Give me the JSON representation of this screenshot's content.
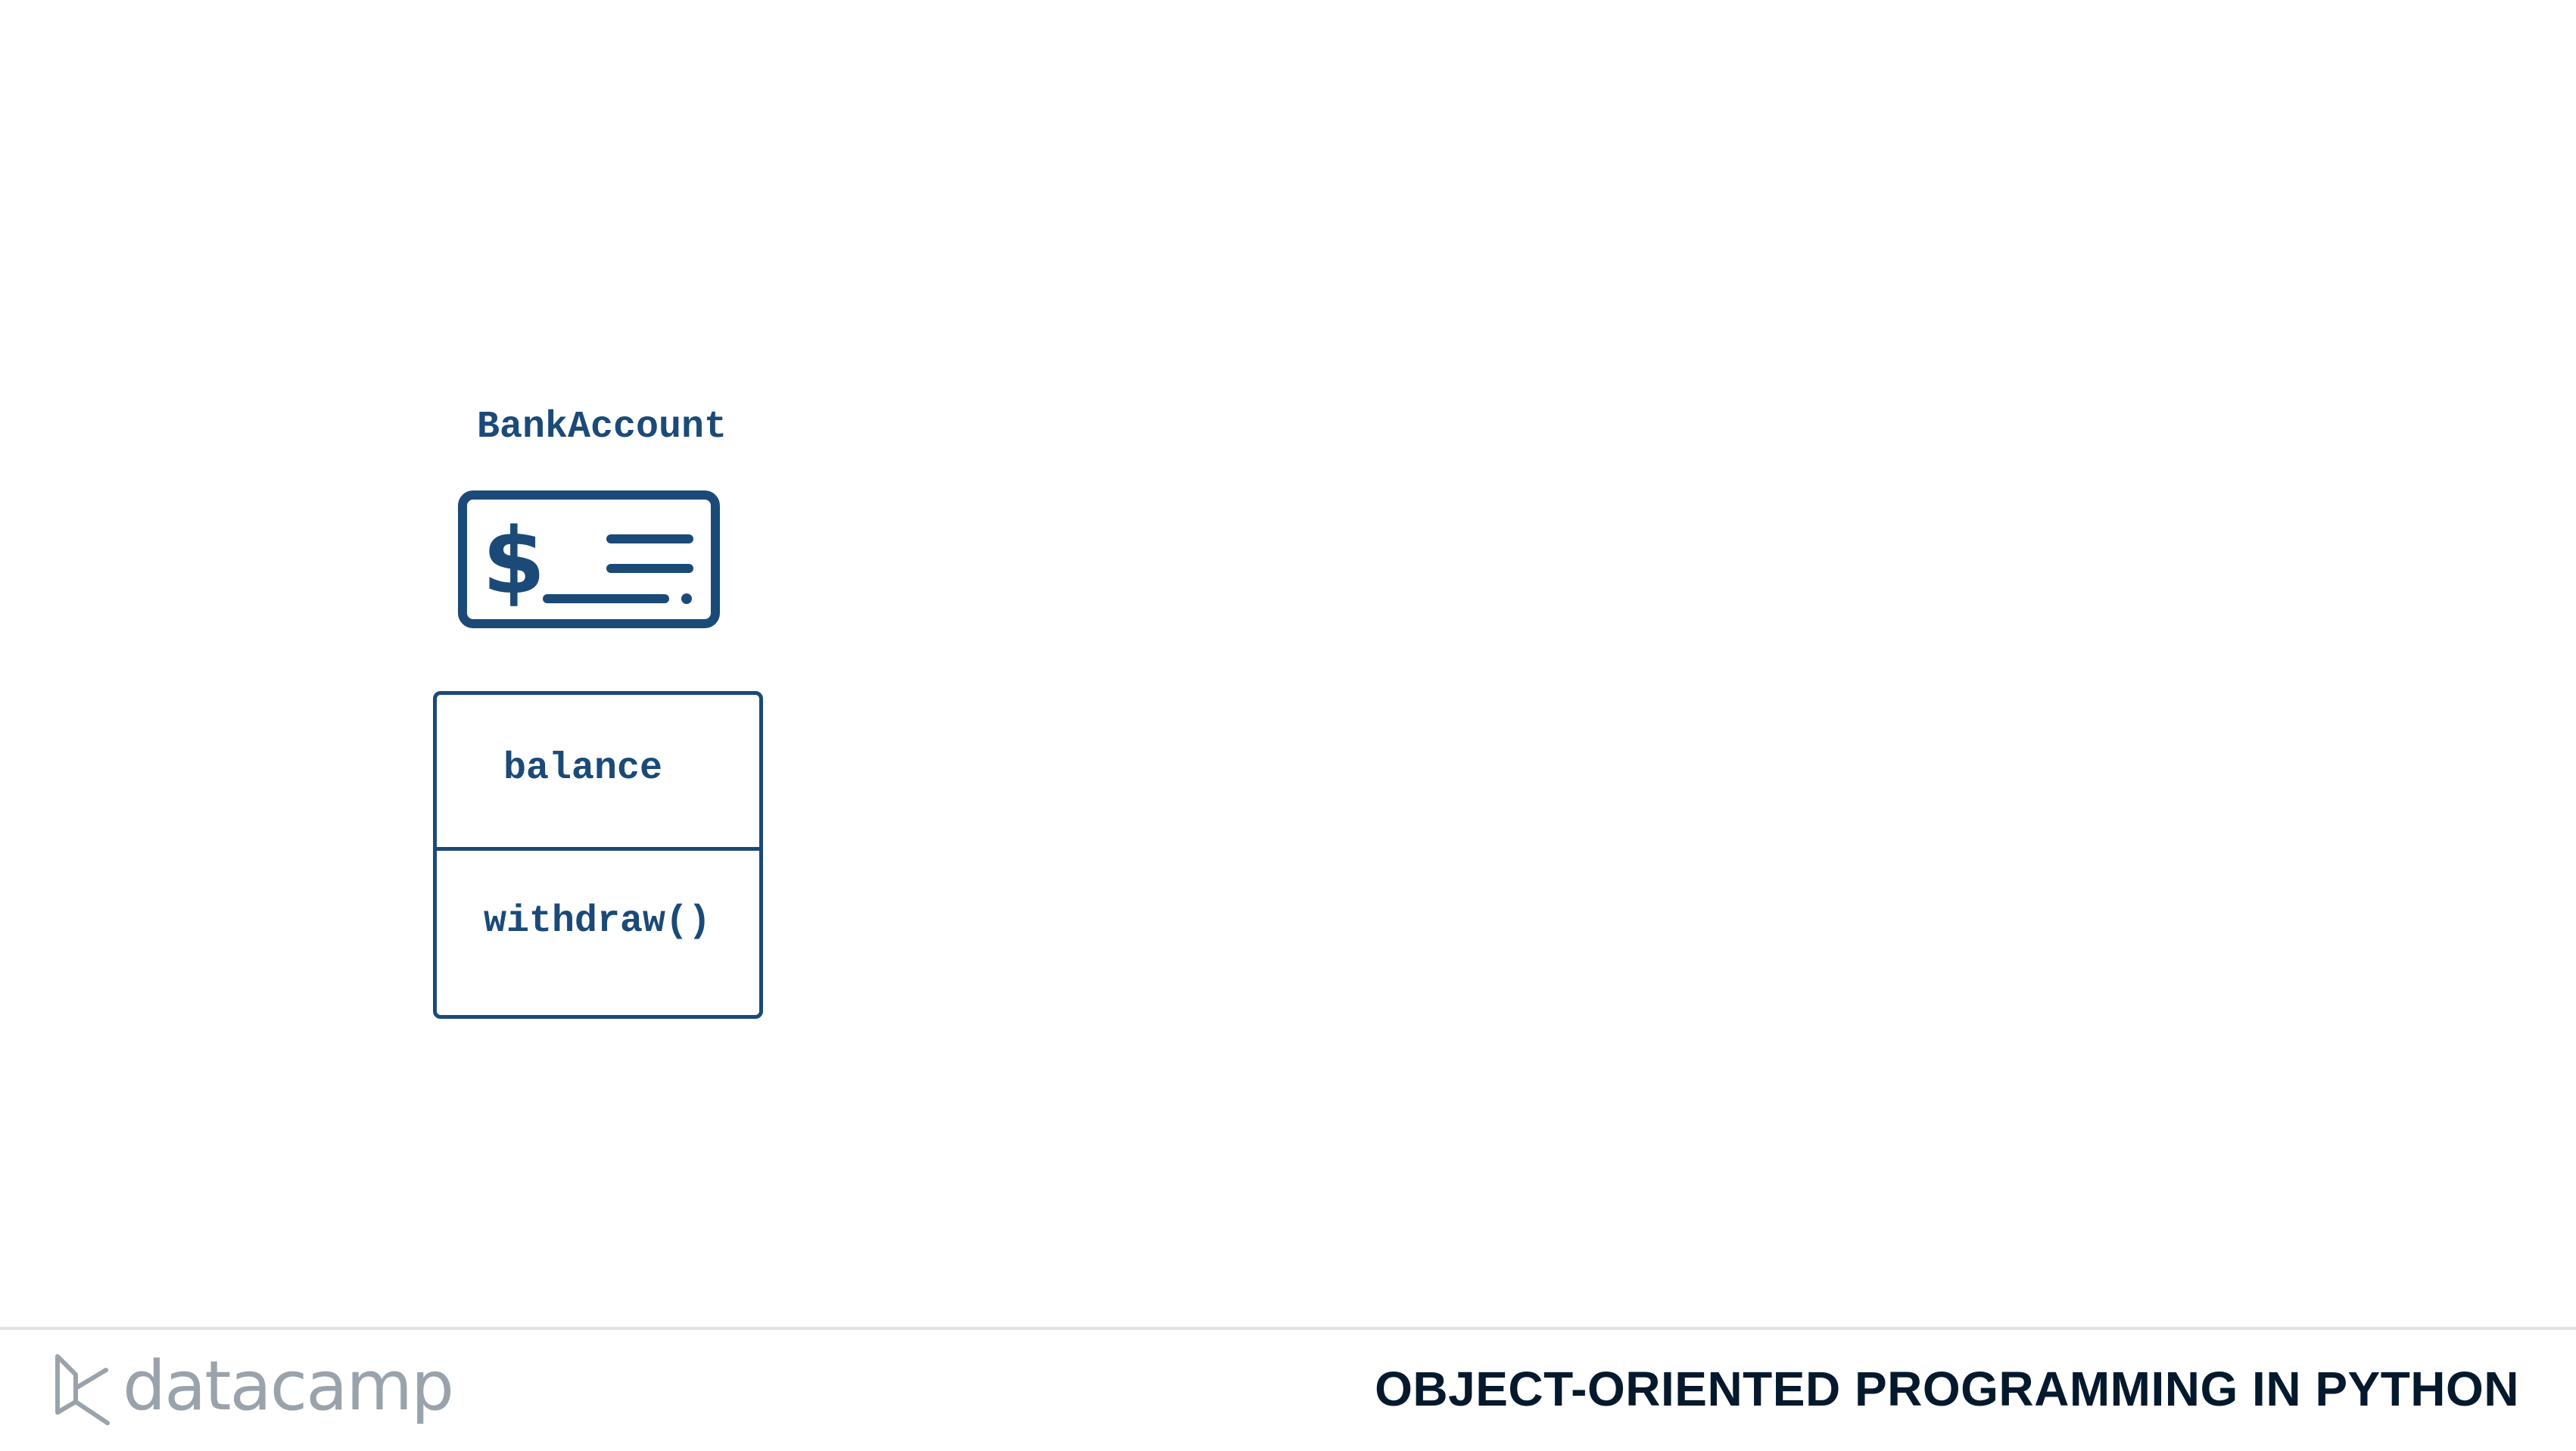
{
  "diagram": {
    "class_name": "BankAccount",
    "icon": "bank-check-icon",
    "attributes": [
      "balance"
    ],
    "methods": [
      "withdraw()"
    ],
    "accent_color": "#1b4a78"
  },
  "footer": {
    "logo_text": "datacamp",
    "logo_icon": "datacamp-logo-icon",
    "course_title": "OBJECT-ORIENTED PROGRAMMING IN PYTHON",
    "logo_color": "#9aa3ab",
    "title_color": "#05192d"
  }
}
